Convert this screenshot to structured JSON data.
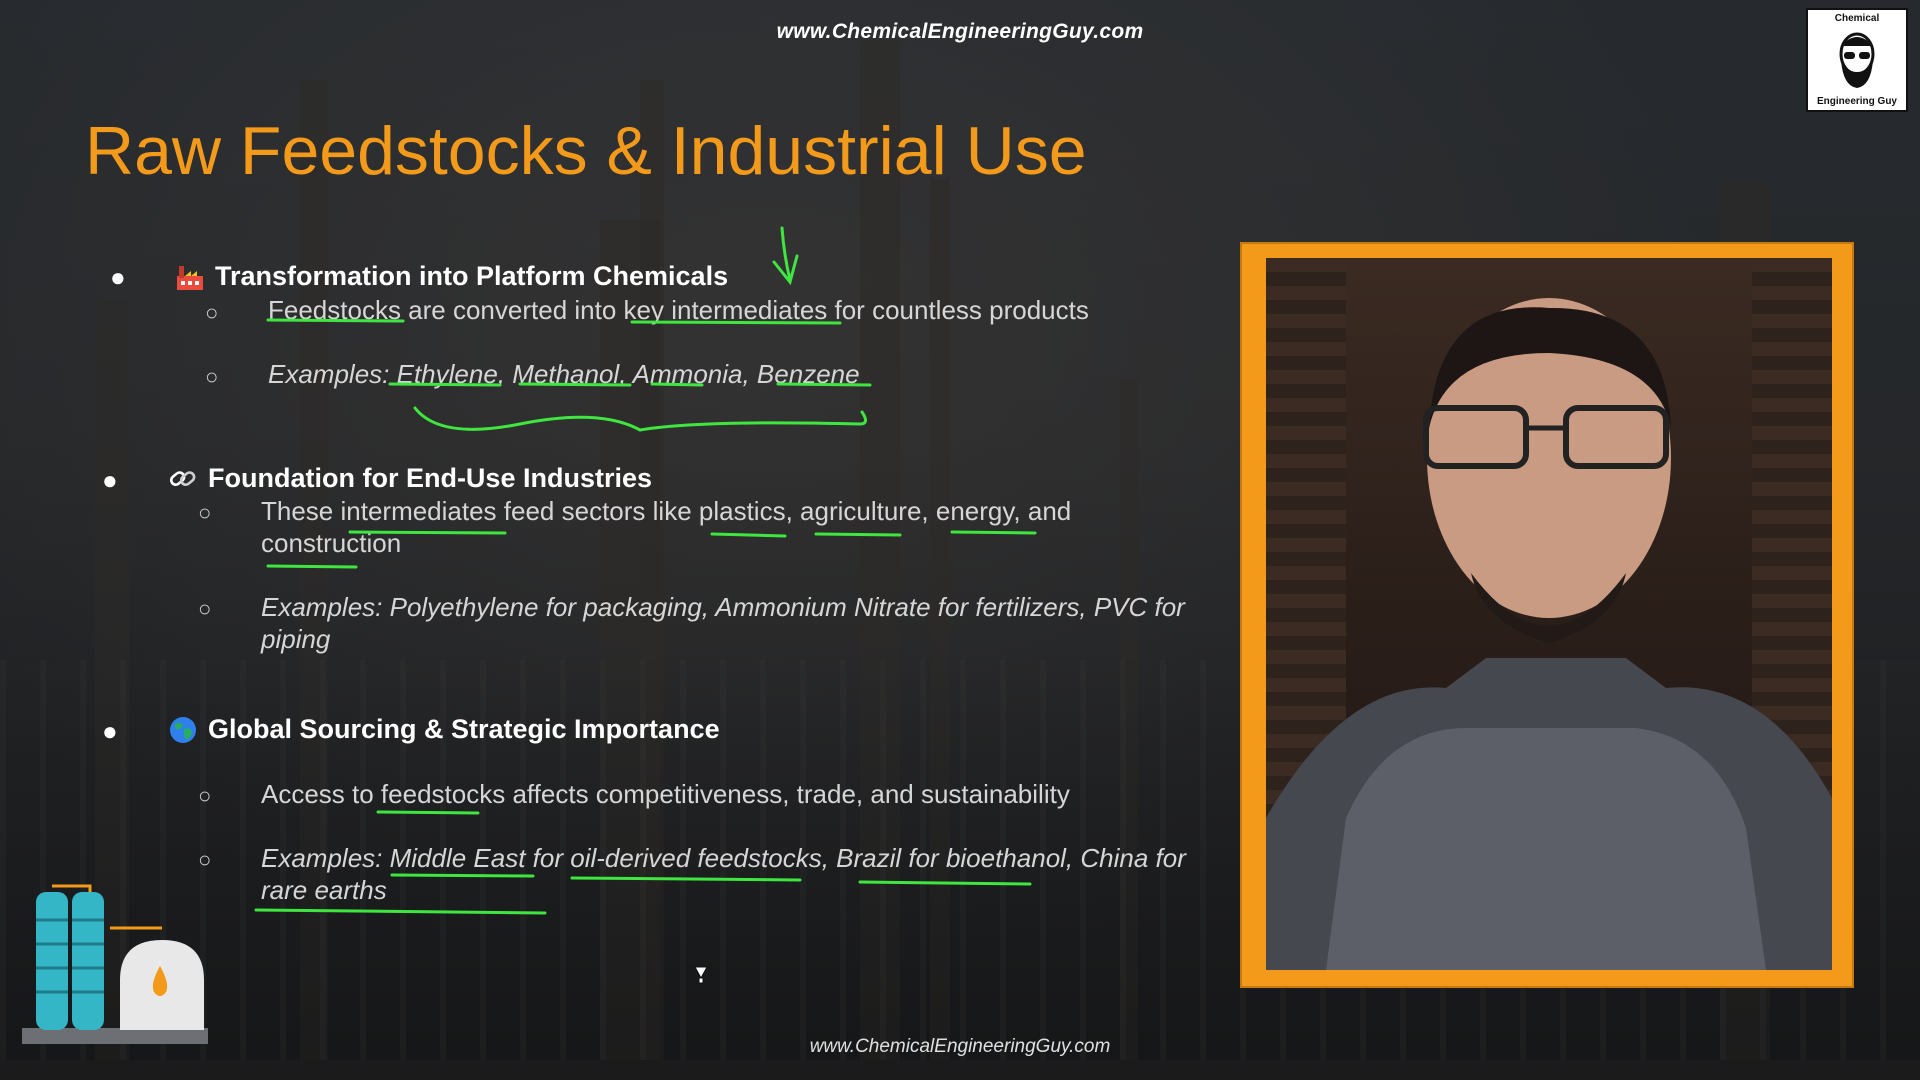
{
  "header": {
    "top_url": "www.ChemicalEngineeringGuy.com",
    "logo_top": "Chemical",
    "logo_bottom": "Engineering Guy"
  },
  "slide": {
    "title": "Raw Feedstocks & Industrial Use",
    "sections": [
      {
        "icon": "factory-icon",
        "heading": "Transformation into Platform Chemicals",
        "points": [
          "Feedstocks are converted into key intermediates for countless products",
          "Examples: Ethylene, Methanol, Ammonia, Benzene"
        ]
      },
      {
        "icon": "link-icon",
        "heading": "Foundation for End-Use Industries",
        "points": [
          "These intermediates feed sectors like plastics, agriculture, energy, and construction",
          "Examples: Polyethylene for packaging, Ammonium Nitrate for fertilizers, PVC for piping"
        ]
      },
      {
        "icon": "globe-icon",
        "heading": "Global Sourcing & Strategic Importance",
        "points": [
          "Access to feedstocks affects competitiveness, trade, and sustainability",
          "Examples: Middle East for oil-derived feedstocks, Brazil for bioethanol, China for rare earths"
        ]
      }
    ],
    "bottom_url": "www.ChemicalEngineeringGuy.com"
  },
  "colors": {
    "title": "#f39a1b",
    "frame": "#f39a1b",
    "annotation": "#3fe63f"
  }
}
